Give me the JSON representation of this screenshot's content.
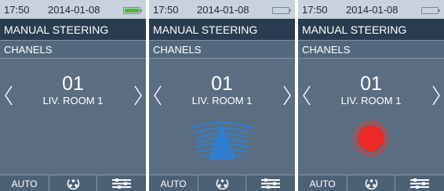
{
  "screens": [
    {
      "status": {
        "time": "17:50",
        "date": "2014-01-08",
        "battery_icon": "battery-full-icon",
        "battery_color": "#4cb43a"
      },
      "header": {
        "title": "MANUAL STEERING"
      },
      "menu": {
        "label": "CHANELS"
      },
      "channel": {
        "number": "01",
        "name": "LIV. ROOM 1"
      },
      "indicator": "none",
      "bottom": {
        "auto_label": "AUTO",
        "mode_icon": "fan-icon",
        "settings_icon": "sliders-icon"
      }
    },
    {
      "status": {
        "time": "17:50",
        "date": "2014-01-08",
        "battery_icon": "battery-empty-icon",
        "battery_color": "#c8d2dc"
      },
      "header": {
        "title": "MANUAL STEERING"
      },
      "menu": {
        "label": "CHANELS"
      },
      "channel": {
        "number": "01",
        "name": "LIV. ROOM 1"
      },
      "indicator": "signal-transmitting-icon",
      "indicator_color": "#2f7fd1",
      "bottom": {
        "auto_label": "AUTO",
        "mode_icon": "fan-icon",
        "settings_icon": "sliders-icon"
      }
    },
    {
      "status": {
        "time": "17:50",
        "date": "2014-01-08",
        "battery_icon": "battery-empty-icon",
        "battery_color": "#c8d2dc"
      },
      "header": {
        "title": "MANUAL STEERING"
      },
      "menu": {
        "label": "CHANELS"
      },
      "channel": {
        "number": "01",
        "name": "LIV. ROOM 1"
      },
      "indicator": "record-icon",
      "indicator_color": "#ec2924",
      "bottom": {
        "auto_label": "AUTO",
        "mode_icon": "fan-icon",
        "settings_icon": "sliders-icon"
      }
    }
  ]
}
